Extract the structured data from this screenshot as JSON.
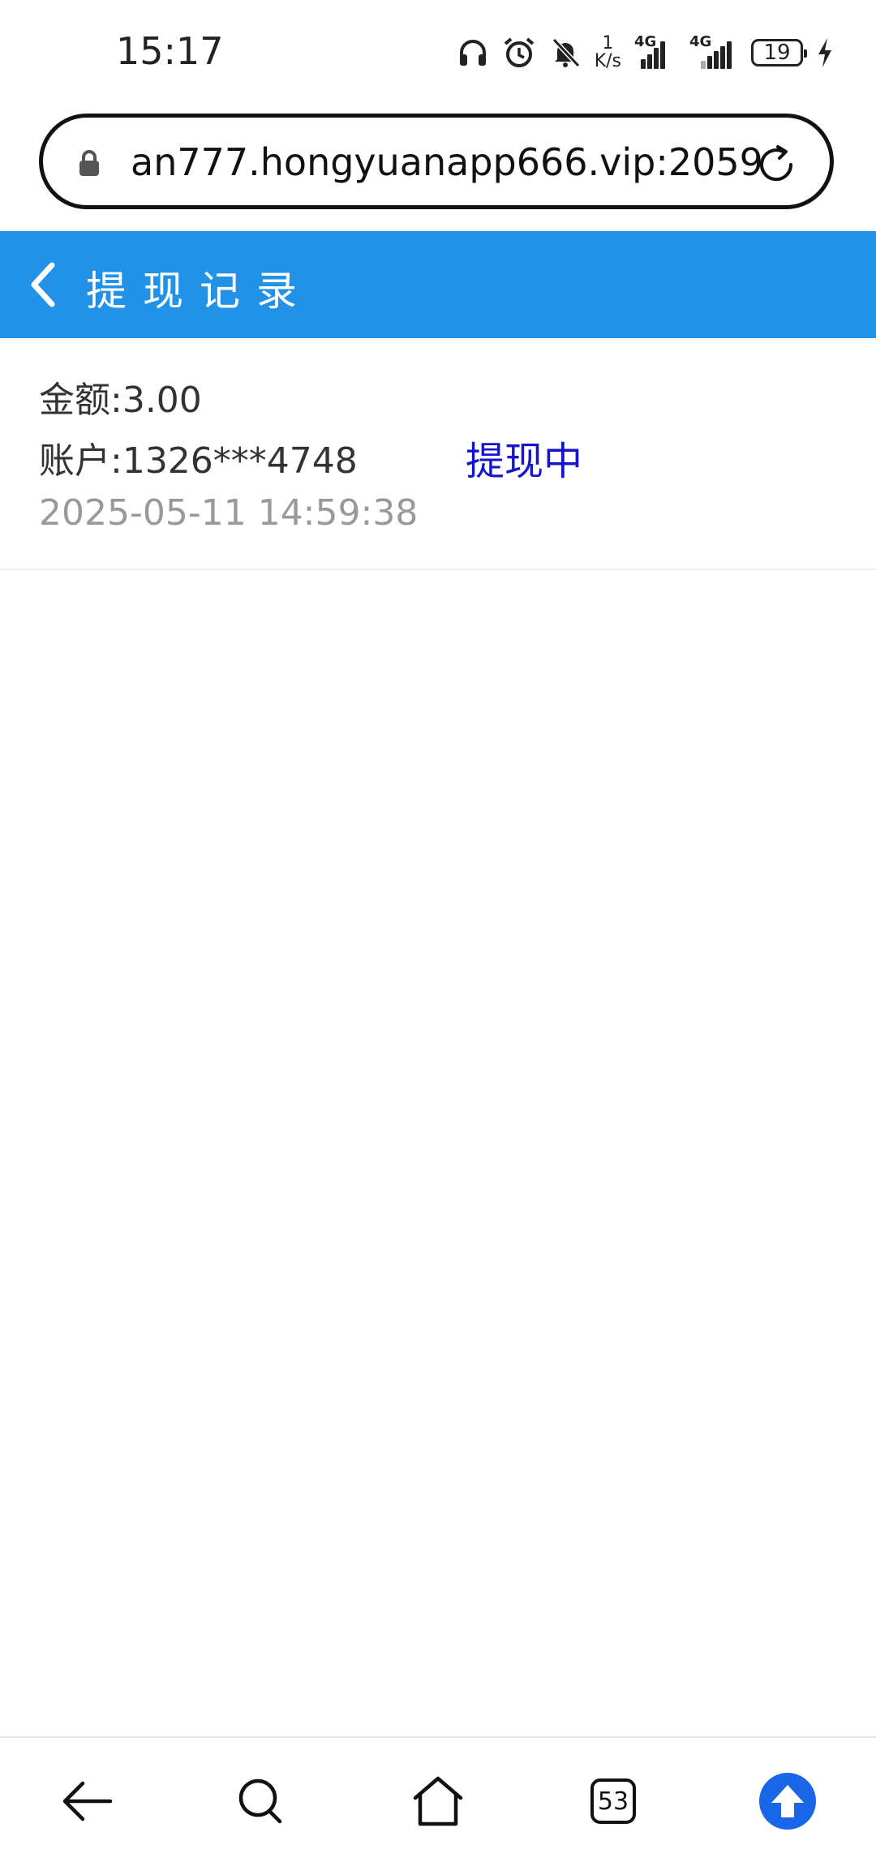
{
  "status_bar": {
    "time": "15:17",
    "net_speed_value": "1",
    "net_speed_unit": "K/s",
    "signal1_label": "4G",
    "signal2_label": "4G",
    "battery_level": "19"
  },
  "browser": {
    "url": "an777.hongyuanapp666.vip:2059",
    "tab_count": "53"
  },
  "header": {
    "title": "提现记录",
    "background": "#2292e8"
  },
  "records": [
    {
      "amount": "金额:3.00",
      "account": "账户:1326***4748",
      "status": "提现中",
      "time": "2025-05-11 14:59:38"
    }
  ],
  "colors": {
    "status_text": "#1414d0",
    "time_text": "#999999",
    "scroll_top_button": "#1a66e8"
  },
  "icons": [
    "lock-icon",
    "refresh-icon",
    "back-icon",
    "headphones-icon",
    "alarm-icon",
    "mute-icon",
    "charging-icon",
    "nav-back-icon",
    "search-icon",
    "home-icon",
    "tabs-icon",
    "scroll-top-icon"
  ]
}
